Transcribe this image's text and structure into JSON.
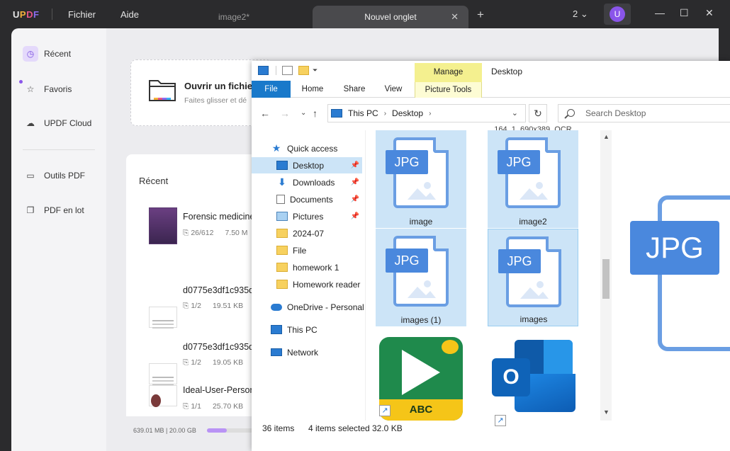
{
  "updf": {
    "logo": "UPDF",
    "menu": [
      "Fichier",
      "Aide"
    ],
    "tabs": [
      {
        "label": "image2*",
        "active": false
      },
      {
        "label": "Nouvel onglet",
        "active": true
      }
    ],
    "account_count": "2",
    "avatar_letter": "U",
    "sidebar": [
      {
        "label": "Récent",
        "icon": "clock-icon",
        "active": true
      },
      {
        "label": "Favoris",
        "icon": "star-icon",
        "active": false
      },
      {
        "label": "UPDF Cloud",
        "icon": "cloud-icon",
        "active": false
      },
      {
        "label": "Outils PDF",
        "icon": "briefcase-icon",
        "active": false
      },
      {
        "label": "PDF en lot",
        "icon": "copy-icon",
        "active": false
      }
    ],
    "open_card": {
      "title": "Ouvrir un fichie",
      "subtitle": "Faites glisser et dé"
    },
    "recent": {
      "heading": "Récent",
      "files": [
        {
          "name": "Forensic medicine",
          "pages": "26/612",
          "size": "7.50 M"
        },
        {
          "name": "d0775e3df1c935d",
          "pages": "1/2",
          "size": "19.51 KB"
        },
        {
          "name": "d0775e3df1c935d",
          "pages": "1/2",
          "size": "19.05 KB"
        },
        {
          "name": "Ideal-User-Persona",
          "pages": "1/1",
          "size": "25.70 KB"
        }
      ]
    },
    "storage": {
      "text": "639.01 MB | 20.00 GB",
      "fraction": 0.4
    },
    "accent": "#8a55ea"
  },
  "explorer": {
    "title": "Desktop",
    "ribbon": {
      "tabs": [
        "File",
        "Home",
        "Share",
        "View"
      ],
      "manage": "Manage",
      "picture_tools": "Picture Tools"
    },
    "address": [
      "This PC",
      "Desktop"
    ],
    "search_placeholder": "Search Desktop",
    "nav": [
      {
        "label": "Quick access",
        "icon": "star-icon"
      },
      {
        "label": "Desktop",
        "icon": "desktop-icon",
        "pinned": true,
        "selected": true
      },
      {
        "label": "Downloads",
        "icon": "download-icon",
        "pinned": true
      },
      {
        "label": "Documents",
        "icon": "document-icon",
        "pinned": true
      },
      {
        "label": "Pictures",
        "icon": "pictures-icon",
        "pinned": true
      },
      {
        "label": "2024-07",
        "icon": "folder-icon"
      },
      {
        "label": "File",
        "icon": "folder-icon"
      },
      {
        "label": "homework 1",
        "icon": "folder-icon"
      },
      {
        "label": "Homework reader",
        "icon": "folder-icon"
      },
      {
        "label": "OneDrive - Personal",
        "icon": "onedrive-icon"
      },
      {
        "label": "This PC",
        "icon": "pc-icon"
      },
      {
        "label": "Network",
        "icon": "network-icon"
      }
    ],
    "top_cut_label": "164_1_690x389_OCR",
    "badge_text": "JPG",
    "files": [
      {
        "label": "image",
        "type": "JPG"
      },
      {
        "label": "image2",
        "type": "JPG"
      },
      {
        "label": "images (1)",
        "type": "JPG"
      },
      {
        "label": "images",
        "type": "JPG"
      }
    ],
    "shortcut_abc": "ABC",
    "outlook_letter": "O",
    "status": {
      "items": "36 items",
      "selected": "4 items selected",
      "size": "32.0 KB"
    },
    "selection_color": "#cce4f7"
  }
}
